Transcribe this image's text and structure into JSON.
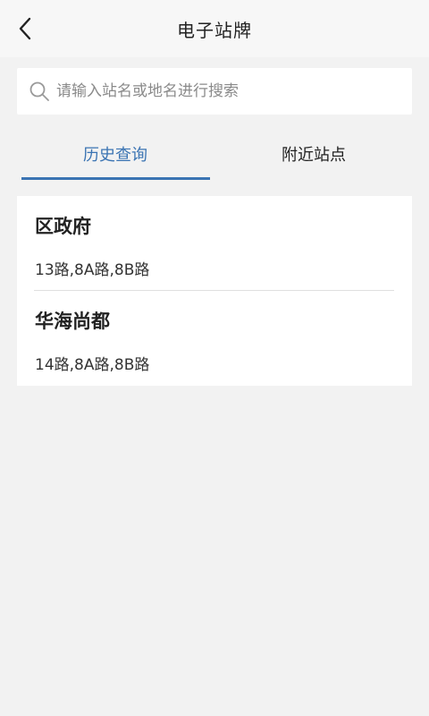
{
  "header": {
    "title": "电子站牌",
    "back_icon": "chevron-left-icon"
  },
  "search": {
    "placeholder": "请输入站名或地名进行搜索",
    "value": "",
    "icon": "search-icon"
  },
  "tabs": [
    {
      "label": "历史查询",
      "active": true
    },
    {
      "label": "附近站点",
      "active": false
    }
  ],
  "history": [
    {
      "name": "区政府",
      "routes": "13路,8A路,8B路"
    },
    {
      "name": "华海尚都",
      "routes": "14路,8A路,8B路"
    }
  ],
  "colors": {
    "accent": "#3b74b3",
    "background": "#f2f2f2",
    "card": "#ffffff",
    "text": "#222222"
  }
}
